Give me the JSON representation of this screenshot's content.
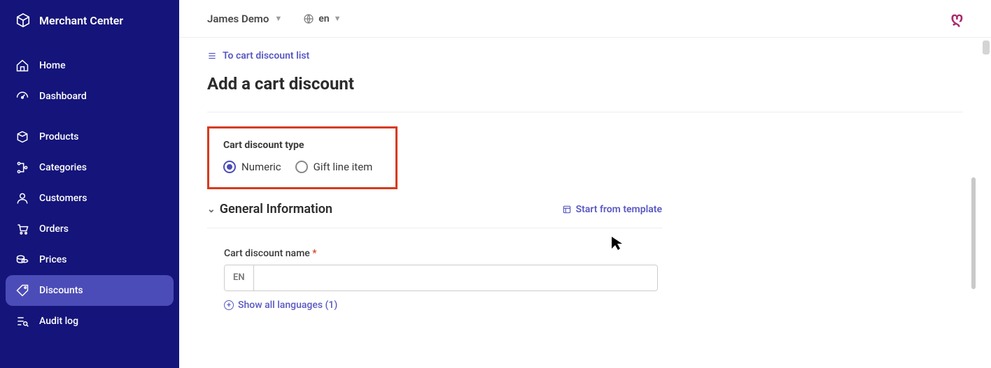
{
  "brand": {
    "title": "Merchant Center"
  },
  "sidebar": {
    "items": [
      {
        "label": "Home"
      },
      {
        "label": "Dashboard"
      },
      {
        "label": "Products"
      },
      {
        "label": "Categories"
      },
      {
        "label": "Customers"
      },
      {
        "label": "Orders"
      },
      {
        "label": "Prices"
      },
      {
        "label": "Discounts"
      },
      {
        "label": "Audit log"
      }
    ]
  },
  "topbar": {
    "project": "James Demo",
    "lang": "en"
  },
  "back_link": "To cart discount list",
  "page_title": "Add a cart discount",
  "discount_type": {
    "label": "Cart discount type",
    "options": {
      "numeric": "Numeric",
      "gift": "Gift line item"
    }
  },
  "sections": {
    "general": "General Information"
  },
  "template_link": "Start from template",
  "form": {
    "name_label": "Cart discount name",
    "lang_chip": "EN",
    "show_languages": "Show all languages (1)"
  }
}
